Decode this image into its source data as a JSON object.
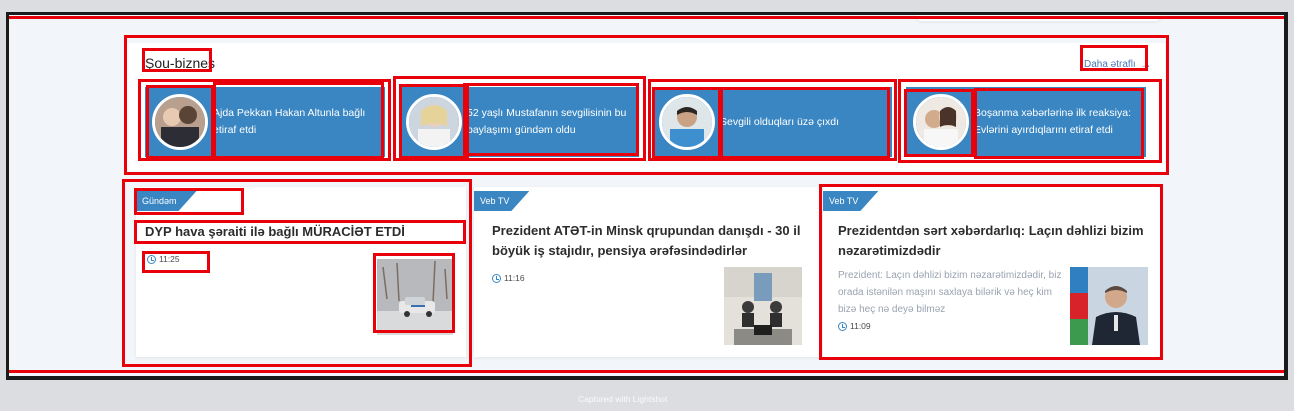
{
  "section": {
    "title": "Şou-biznes",
    "more_label": "Daha ətraflı",
    "more_icon": "arrow-right-icon"
  },
  "stories": [
    {
      "text": "Ajda Pekkan Hakan Altunla bağlı etiraf etdi"
    },
    {
      "text": "52 yaşlı Mustafanın sevgilisinin bu paylaşımı gündəm oldu"
    },
    {
      "text": "Sevgili olduqları üzə çıxdı"
    },
    {
      "text": "Boşanma xəbərlərinə ilk reaksiya: Evlərini ayırdıqlarını etiraf etdi"
    }
  ],
  "cards": [
    {
      "tag": "Gündəm",
      "title": "DYP hava şəraiti ilə bağlı MÜRACİƏT ETDİ",
      "time": "11:25"
    },
    {
      "tag": "Veb TV",
      "title": "Prezident ATƏT-in Minsk qrupundan danışdı - 30 il böyük iş stajıdır, pensiya ərəfəsindədirlər",
      "time": "11:16"
    },
    {
      "tag": "Veb TV",
      "title": "Prezidentdən sərt xəbərdarlıq: Laçın dəhlizi bizim nəzarətimizdədir",
      "excerpt": "Prezident: Laçın dəhlizi bizim nəzarətimizdədir, biz orada istənilən maşını saxlaya bilərik və heç kim bizə heç nə deyə bilməz",
      "time": "11:09"
    }
  ],
  "footer": {
    "caption": "Captured with Lightshot"
  },
  "colors": {
    "accent": "#3a86c2",
    "highlight": "#e8000b"
  }
}
